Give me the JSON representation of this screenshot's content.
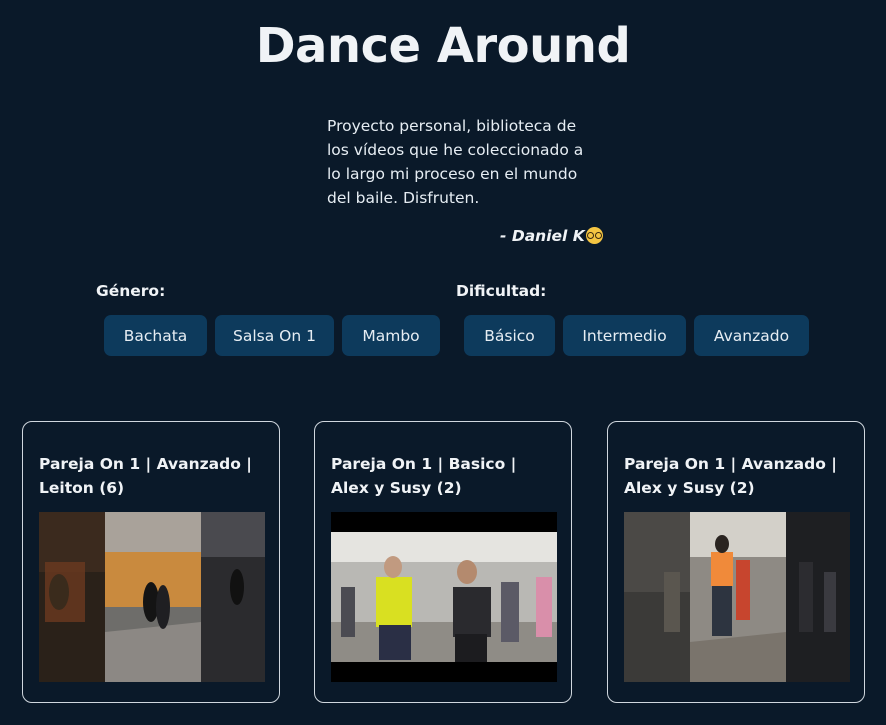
{
  "header": {
    "title": "Dance Around",
    "intro": "Proyecto personal, biblioteca de los vídeos que he coleccionado a lo largo mi proceso en el mundo del baile. Disfruten.",
    "signature": "- Daniel K"
  },
  "filters": {
    "genre_label": "Género:",
    "genre_buttons": [
      "Bachata",
      "Salsa On 1",
      "Mambo"
    ],
    "difficulty_label": "Dificultad:",
    "difficulty_buttons": [
      "Básico",
      "Intermedio",
      "Avanzado"
    ]
  },
  "videos": [
    {
      "title": "Pareja On 1 | Avanzado | Leiton (6)"
    },
    {
      "title": "Pareja On 1 | Basico | Alex y Susy (2)"
    },
    {
      "title": "Pareja On 1 | Avanzado | Alex y Susy (2)"
    }
  ],
  "colors": {
    "background": "#0a1929",
    "button": "#0d3a5c",
    "card_border": "#d0d7de",
    "text": "#e6edf3"
  },
  "icons": {
    "signature_emoji": "nerd-face-icon"
  }
}
